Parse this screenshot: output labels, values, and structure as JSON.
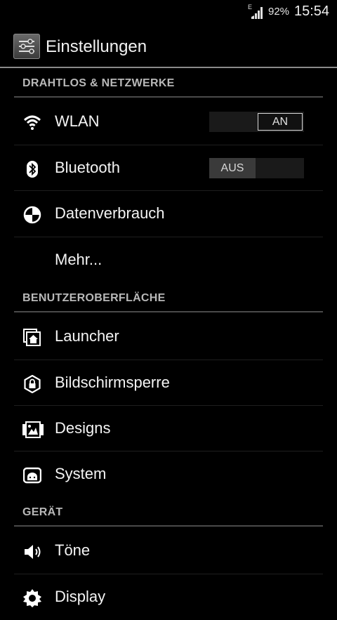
{
  "status_bar": {
    "network_type": "E",
    "battery": "92%",
    "time": "15:54"
  },
  "action_bar": {
    "title": "Einstellungen",
    "icon": "settings-sliders-icon"
  },
  "sections": [
    {
      "header": "DRAHTLOS & NETZWERKE",
      "items": [
        {
          "label": "WLAN",
          "icon": "wifi-icon",
          "switch": "AN"
        },
        {
          "label": "Bluetooth",
          "icon": "bluetooth-icon",
          "switch": "AUS"
        },
        {
          "label": "Datenverbrauch",
          "icon": "data-usage-icon"
        },
        {
          "label": "Mehr..."
        }
      ]
    },
    {
      "header": "BENUTZEROBERFLÄCHE",
      "items": [
        {
          "label": "Launcher",
          "icon": "launcher-home-icon"
        },
        {
          "label": "Bildschirmsperre",
          "icon": "lock-screen-icon"
        },
        {
          "label": "Designs",
          "icon": "themes-icon"
        },
        {
          "label": "System",
          "icon": "system-icon"
        }
      ]
    },
    {
      "header": "GERÄT",
      "items": [
        {
          "label": "Töne",
          "icon": "speaker-icon"
        },
        {
          "label": "Display",
          "icon": "display-brightness-icon"
        }
      ]
    }
  ]
}
